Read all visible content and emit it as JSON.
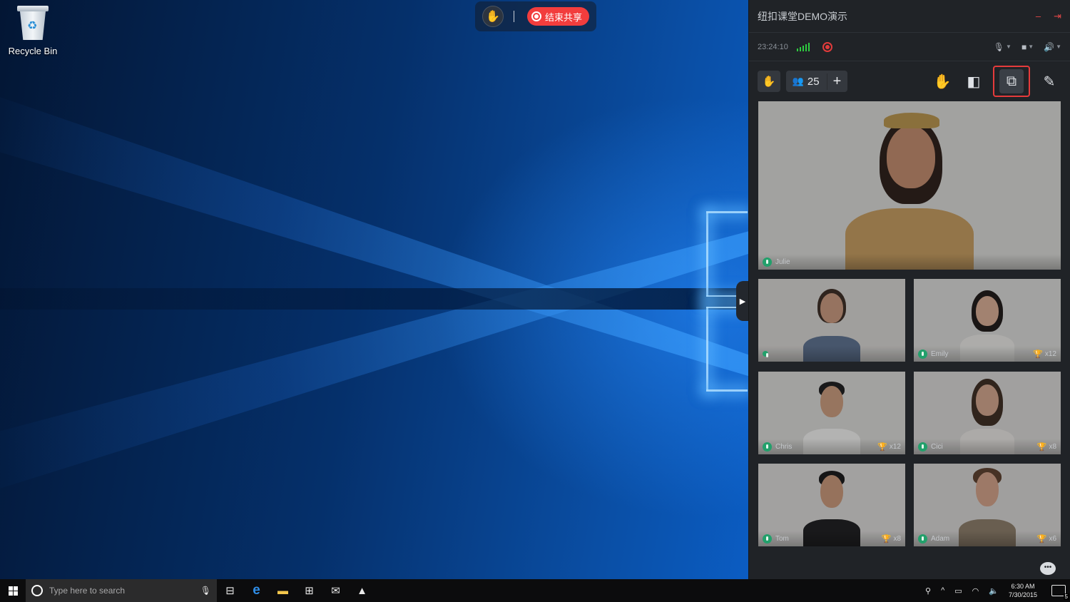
{
  "desktop": {
    "recycle_bin_label": "Recycle Bin"
  },
  "share_toolbar": {
    "end_share_label": "结束共享"
  },
  "panel": {
    "title": "纽扣课堂DEMO演示",
    "clock": "23:24:10",
    "participant_count": "25"
  },
  "tiles": [
    {
      "name": "Julie",
      "trophy": ""
    },
    {
      "name": "",
      "trophy": ""
    },
    {
      "name": "Emily",
      "trophy": "x12"
    },
    {
      "name": "Chris",
      "trophy": "x12"
    },
    {
      "name": "Cici",
      "trophy": "x8"
    },
    {
      "name": "Tom",
      "trophy": "x8"
    },
    {
      "name": "Adam",
      "trophy": "x6"
    }
  ],
  "taskbar": {
    "search_placeholder": "Type here to search",
    "time": "6:30 AM",
    "date": "7/30/2015",
    "notification_count": "5"
  },
  "colors": {
    "end_share_red": "#f23d3d",
    "panel_bg": "#202327",
    "highlight_border": "#e63b3b",
    "mic_green": "#22a06b",
    "trophy_gold": "#e2b428"
  }
}
